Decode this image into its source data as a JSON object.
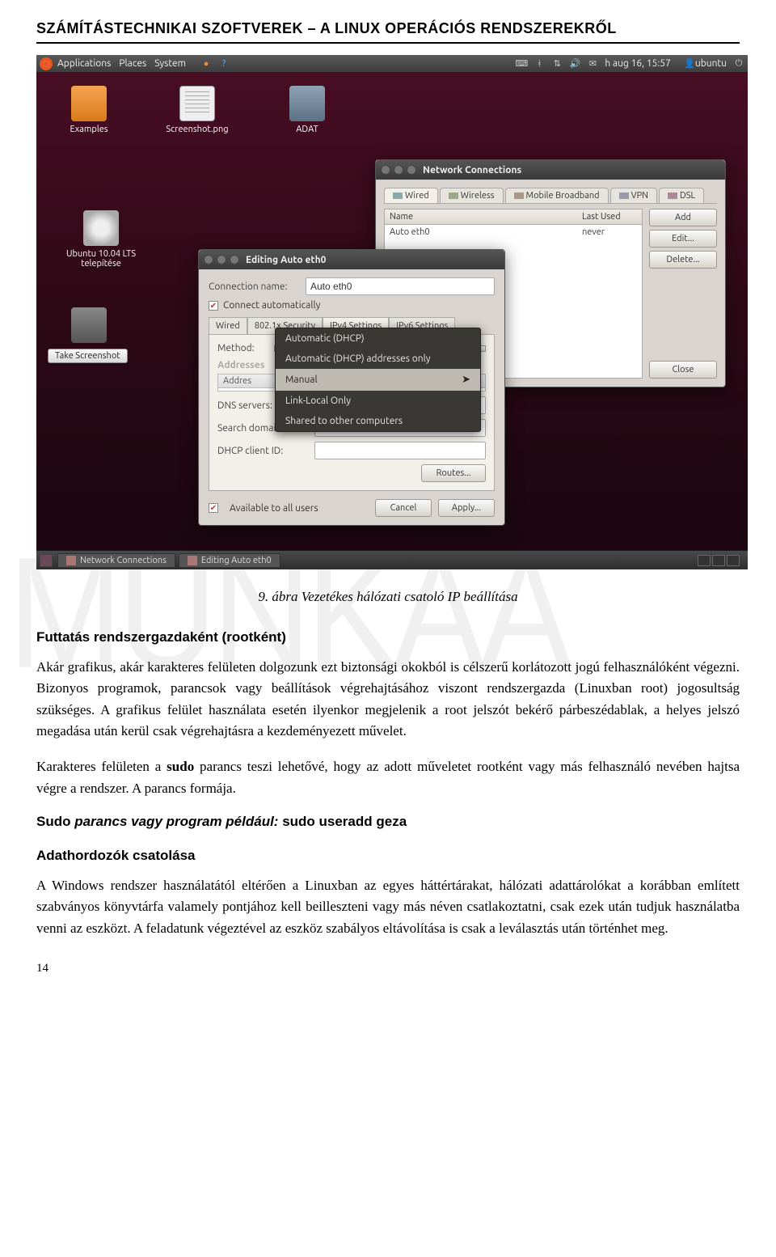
{
  "doc": {
    "header": "SZÁMÍTÁSTECHNIKAI SZOFTVEREK – A LINUX OPERÁCIÓS RENDSZEREKRŐL",
    "caption": "9. ábra Vezetékes hálózati csatoló IP beállítása",
    "heading1": "Futtatás rendszergazdaként (rootként)",
    "para1": "Akár grafikus, akár karakteres felületen dolgozunk ezt biztonsági okokból is célszerű korlátozott jogú felhasználóként végezni. Bizonyos programok, parancsok vagy beállítások végrehajtásához viszont rendszergazda (Linuxban root) jogosultság szükséges. A grafikus felület használata esetén ilyenkor megjelenik a root jelszót bekérő párbeszédablak, a helyes jelszó megadása után kerül csak végrehajtásra a kezdeményezett művelet.",
    "para2_a": "Karakteres felületen a ",
    "para2_sudo": "sudo",
    "para2_b": " parancs teszi lehetővé, hogy az adott műveletet rootként vagy más felhasználó nevében hajtsa végre a rendszer. A parancs formája.",
    "sudo_intro_a": "Sudo ",
    "sudo_intro_b": "parancs vagy program például: ",
    "sudo_cmd": "sudo useradd geza",
    "heading2": "Adathordozók csatolása",
    "para3": "A Windows rendszer használatától eltérően a Linuxban az egyes háttértárakat, hálózati adattárolókat a korábban említett szabványos könyvtárfa valamely pontjához kell beilleszteni vagy más néven csatlakoztatni, csak ezek után tudjuk használatba venni az eszközt. A feladatunk végeztével az eszköz szabályos eltávolítása is csak a leválasztás után történhet meg.",
    "pagenum": "14",
    "watermark": "MUNKAA"
  },
  "panel": {
    "menu": [
      "Applications",
      "Places",
      "System"
    ],
    "clock": "h aug 16, 15:57",
    "user": "ubuntu"
  },
  "desktop": {
    "examples": "Examples",
    "screenshotpng": "Screenshot.png",
    "adat": "ADAT",
    "install": "Ubuntu 10.04 LTS telepítése",
    "takeshot": "Take Screenshot"
  },
  "nc": {
    "title": "Network Connections",
    "tabs": [
      "Wired",
      "Wireless",
      "Mobile Broadband",
      "VPN",
      "DSL"
    ],
    "col_name": "Name",
    "col_last": "Last Used",
    "row_name": "Auto eth0",
    "row_last": "never",
    "btn_add": "Add",
    "btn_edit": "Edit...",
    "btn_delete": "Delete...",
    "btn_close": "Close"
  },
  "ed": {
    "title": "Editing Auto eth0",
    "lbl_connname": "Connection name:",
    "val_connname": "Auto eth0",
    "chk_auto": "Connect automatically",
    "tabs": [
      "Wired",
      "802.1x Security",
      "IPv4 Settings",
      "IPv6 Settings"
    ],
    "lbl_method": "Method:",
    "hdr_addresses": "Addresses",
    "addr_col": "Addres",
    "lbl_dns": "DNS servers:",
    "lbl_search": "Search domains:",
    "lbl_dhcp": "DHCP client ID:",
    "btn_routes": "Routes...",
    "chk_all": "Available to all users",
    "btn_cancel": "Cancel",
    "btn_apply": "Apply..."
  },
  "dropdown": {
    "items": [
      "Automatic (DHCP)",
      "Automatic (DHCP) addresses only",
      "Manual",
      "Link-Local Only",
      "Shared to other computers"
    ],
    "selected_index": 2
  },
  "taskbar": {
    "nc": "Network Connections",
    "ed": "Editing Auto eth0"
  }
}
